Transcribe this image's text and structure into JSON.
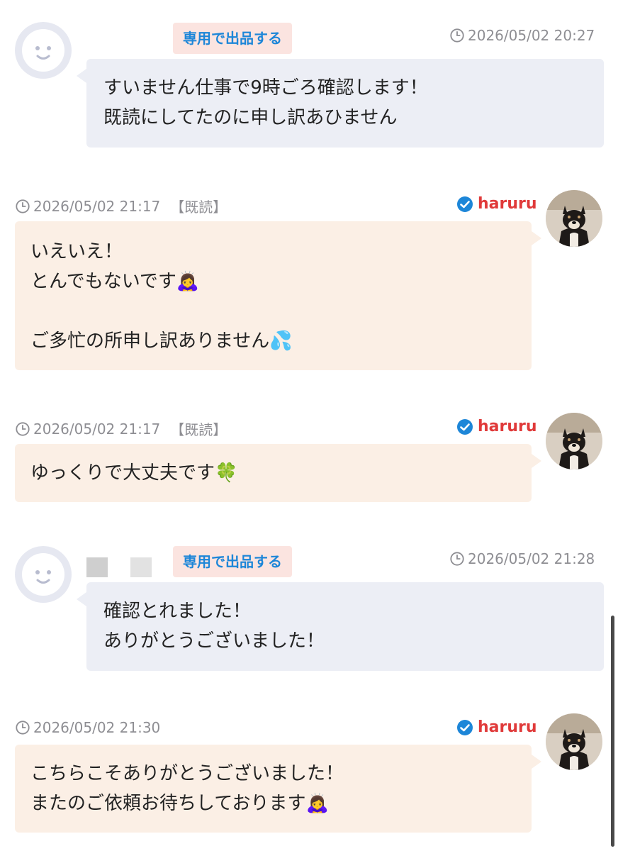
{
  "messages": [
    {
      "sender": "other",
      "tag": "専用で出品する",
      "timestamp": "2026/05/02 20:27",
      "text": "すいません仕事で9時ごろ確認します！\n既読にしてたのに申し訳あひません"
    },
    {
      "sender": "self",
      "timestamp": "2026/05/02 21:17",
      "read_status": "【既読】",
      "username": "haruru",
      "text": "いえいえ！\nとんでもないです🙇‍♀️\n\nご多忙の所申し訳ありません💦"
    },
    {
      "sender": "self",
      "timestamp": "2026/05/02 21:17",
      "read_status": "【既読】",
      "username": "haruru",
      "text": "ゆっくりで大丈夫です🍀"
    },
    {
      "sender": "other",
      "tag": "専用で出品する",
      "timestamp": "2026/05/02 21:28",
      "text": "確認とれました！\nありがとうございました！"
    },
    {
      "sender": "self",
      "timestamp": "2026/05/02 21:30",
      "username": "haruru",
      "text": "こちらこそありがとうございました！\nまたのご依頼お待ちしております🙇‍♀️"
    }
  ],
  "icons": {
    "clock": "clock-icon",
    "verified": "verified-check-icon",
    "avatar_default": "default-face-avatar",
    "avatar_user": "shiba-dog-avatar"
  },
  "colors": {
    "other_bubble": "#eceef5",
    "self_bubble": "#fbefe5",
    "tag_bg": "#fbe4e0",
    "tag_text": "#1d86d8",
    "username": "#e03a3a",
    "verified": "#1d86d8",
    "timestamp": "#8e8e93"
  }
}
